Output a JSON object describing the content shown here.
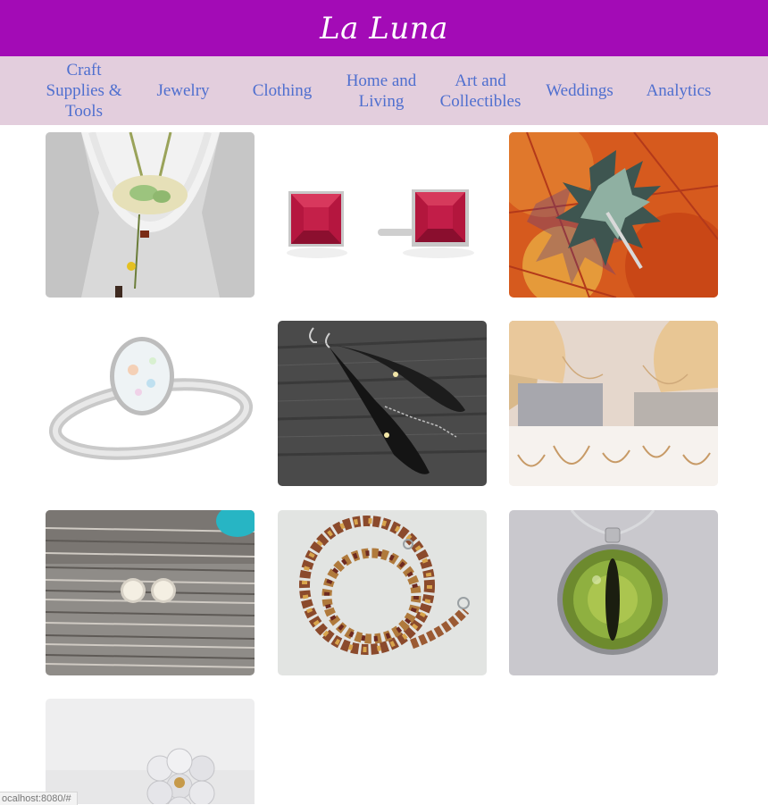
{
  "header": {
    "brand": "La Luna",
    "color": "#a30bb6"
  },
  "nav": {
    "background": "#e3cedd",
    "items": [
      {
        "label": "Craft Supplies & Tools"
      },
      {
        "label": "Jewelry"
      },
      {
        "label": "Clothing"
      },
      {
        "label": "Home and Living"
      },
      {
        "label": "Art and Collectibles"
      },
      {
        "label": "Weddings"
      },
      {
        "label": "Analytics"
      }
    ]
  },
  "products": [
    {
      "image": "ceramic-pendant-necklace"
    },
    {
      "image": "red-square-stud-earrings"
    },
    {
      "image": "enamel-leaf-brooch"
    },
    {
      "image": "opal-ring"
    },
    {
      "image": "black-feather-earrings"
    },
    {
      "image": "delicate-gold-necklaces"
    },
    {
      "image": "white-stone-stud-earrings"
    },
    {
      "image": "mookaite-bead-necklace"
    },
    {
      "image": "green-eye-cabochon-pendant"
    },
    {
      "image": "mother-of-pearl-flower-ring"
    }
  ],
  "status_bar": {
    "url": "ocalhost:8080/#"
  }
}
